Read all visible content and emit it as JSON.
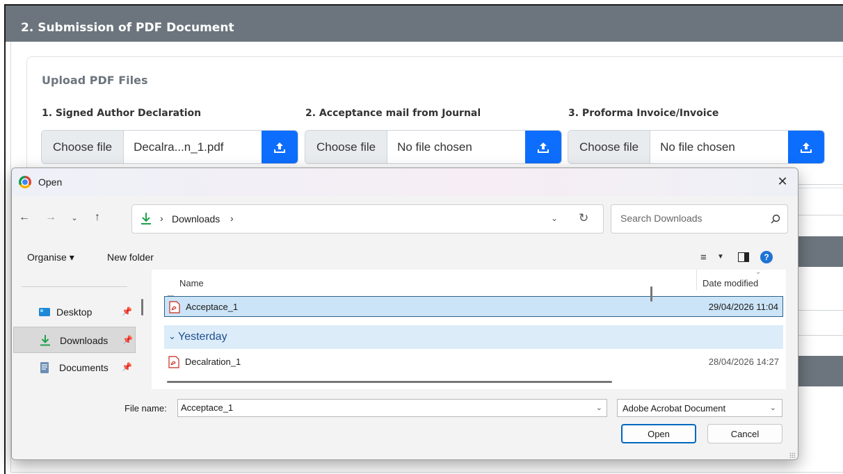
{
  "page": {
    "section_title": "2. Submission of PDF Document",
    "upload_heading": "Upload PDF Files",
    "fields": [
      {
        "label": "1. Signed Author Declaration",
        "choose_label": "Choose file",
        "file_name": "Decalra...n_1.pdf"
      },
      {
        "label": "2. Acceptance mail from Journal",
        "choose_label": "Choose file",
        "file_name": "No file chosen"
      },
      {
        "label": "3. Proforma Invoice/Invoice",
        "choose_label": "Choose file",
        "file_name": "No file chosen"
      }
    ]
  },
  "dialog": {
    "title": "Open",
    "address": {
      "folder": "Downloads"
    },
    "search": {
      "placeholder": "Search Downloads"
    },
    "toolbar": {
      "organise_label": "Organise ▾",
      "new_folder_label": "New folder"
    },
    "nav_items": [
      {
        "label": "Desktop",
        "selected": false
      },
      {
        "label": "Downloads",
        "selected": true
      },
      {
        "label": "Documents",
        "selected": false
      }
    ],
    "columns": {
      "name": "Name",
      "date_modified": "Date modified"
    },
    "files": [
      {
        "name": "Acceptace_1",
        "date": "29/04/2026 11:04",
        "selected": true
      },
      {
        "name": "Decalration_1",
        "date": "28/04/2026 14:27",
        "selected": false
      }
    ],
    "group_label": "Yesterday",
    "file_name_label": "File name:",
    "file_name_value": "Acceptace_1",
    "file_type": "Adobe Acrobat Document",
    "open_label": "Open",
    "cancel_label": "Cancel"
  },
  "colors": {
    "header_bg": "#6c757d",
    "primary_blue": "#0d6efd",
    "selection_bg": "#cce4f7",
    "group_text": "#1e4f8c"
  }
}
